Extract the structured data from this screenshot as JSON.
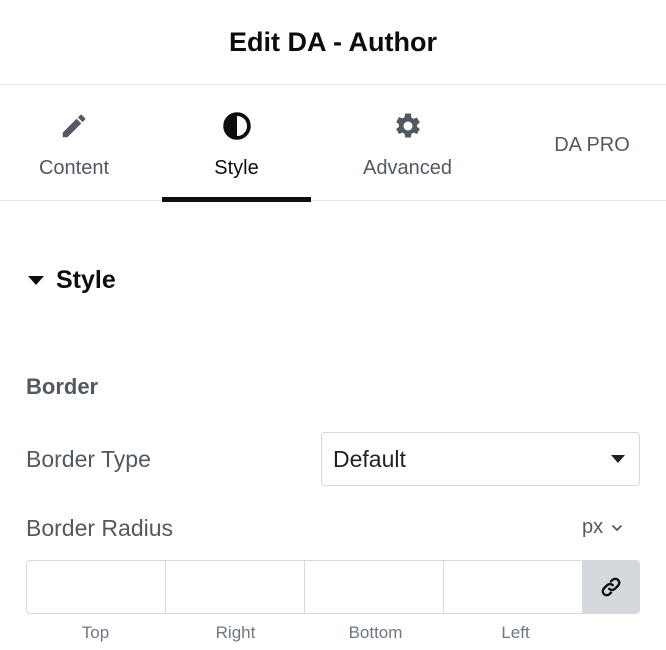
{
  "header": {
    "title": "Edit DA - Author"
  },
  "tabs": [
    {
      "label": "Content",
      "icon": "pencil-icon"
    },
    {
      "label": "Style",
      "icon": "contrast-icon",
      "active": true
    },
    {
      "label": "Advanced",
      "icon": "gear-icon"
    },
    {
      "label": "DA PRO"
    }
  ],
  "section": {
    "title": "Style",
    "expanded": true
  },
  "border": {
    "group_title": "Border",
    "type_label": "Border Type",
    "type_value": "Default",
    "radius_label": "Border Radius",
    "unit": "px",
    "dimensions": [
      {
        "label": "Top",
        "value": ""
      },
      {
        "label": "Right",
        "value": ""
      },
      {
        "label": "Bottom",
        "value": ""
      },
      {
        "label": "Left",
        "value": ""
      }
    ]
  }
}
